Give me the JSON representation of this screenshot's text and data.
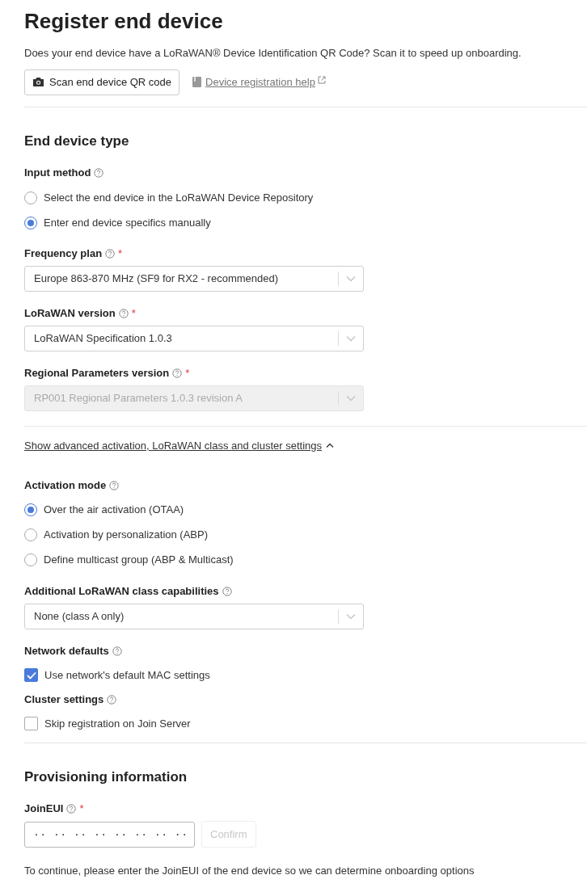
{
  "title": "Register end device",
  "intro": "Does your end device have a LoRaWAN® Device Identification QR Code? Scan it to speed up onboarding.",
  "scan_button": "Scan end device QR code",
  "help_link": "Device registration help",
  "blocks": [
    {
      "kind": "divider"
    },
    {
      "kind": "heading",
      "text": "End device type"
    },
    {
      "kind": "radio",
      "label": "Input method",
      "options": [
        {
          "label": "Select the end device in the LoRaWAN Device Repository",
          "selected": false
        },
        {
          "label": "Enter end device specifics manually",
          "selected": true
        }
      ]
    },
    {
      "kind": "select",
      "label": "Frequency plan",
      "required_mark": "*",
      "value": "Europe 863-870 MHz (SF9 for RX2 - recommended)",
      "disabled": false
    },
    {
      "kind": "select",
      "label": "LoRaWAN version",
      "required_mark": "*",
      "value": "LoRaWAN Specification 1.0.3",
      "disabled": false
    },
    {
      "kind": "select",
      "label": "Regional Parameters version",
      "required_mark": "*",
      "value": "RP001 Regional Parameters 1.0.3 revision A",
      "disabled": true
    },
    {
      "kind": "divider"
    },
    {
      "kind": "toggle",
      "text": "Show advanced activation, LoRaWAN class and cluster settings",
      "expanded": true
    },
    {
      "kind": "radio",
      "label": "Activation mode",
      "options": [
        {
          "label": "Over the air activation (OTAA)",
          "selected": true
        },
        {
          "label": "Activation by personalization (ABP)",
          "selected": false
        },
        {
          "label": "Define multicast group (ABP & Multicast)",
          "selected": false
        }
      ]
    },
    {
      "kind": "select",
      "label": "Additional LoRaWAN class capabilities",
      "value": "None (class A only)",
      "disabled": false
    },
    {
      "kind": "checkbox",
      "label": "Network defaults",
      "option": "Use network's default MAC settings",
      "checked": true
    },
    {
      "kind": "checkbox",
      "label": "Cluster settings",
      "option": "Skip registration on Join Server",
      "checked": false
    },
    {
      "kind": "divider"
    },
    {
      "kind": "heading",
      "text": "Provisioning information"
    },
    {
      "kind": "eui",
      "label": "JoinEUI",
      "required_mark": "*",
      "placeholder": "·· ·· ·· ·· ·· ·· ·· ··",
      "button": "Confirm",
      "button_disabled": true,
      "note": "To continue, please enter the JoinEUI of the end device so we can determine onboarding options"
    }
  ]
}
